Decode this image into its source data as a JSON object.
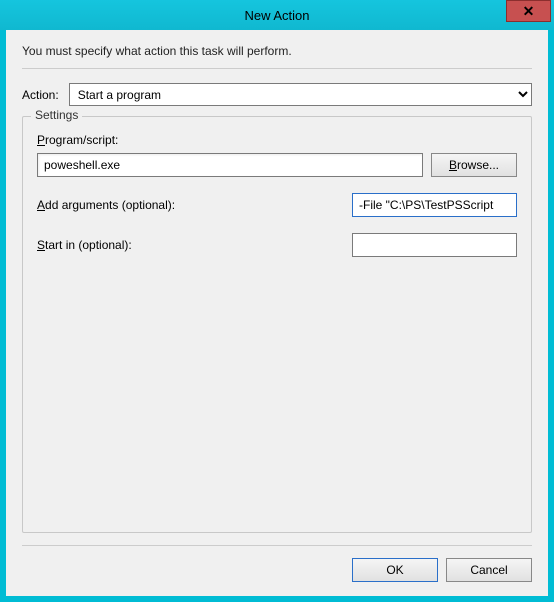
{
  "titlebar": {
    "title": "New Action",
    "close_glyph": "✕"
  },
  "instruction": "You must specify what action this task will perform.",
  "action": {
    "label": "Action:",
    "selected": "Start a program"
  },
  "settings": {
    "legend": "Settings",
    "program": {
      "label_u": "P",
      "label_rest": "rogram/script:",
      "value": "poweshell.exe",
      "browse_u": "B",
      "browse_rest": "rowse..."
    },
    "arguments": {
      "label_u": "A",
      "label_rest": "dd arguments (optional):",
      "value": "-File \"C:\\PS\\TestPSScript"
    },
    "startin": {
      "label_u": "S",
      "label_rest": "tart in (optional):",
      "value": ""
    }
  },
  "buttons": {
    "ok": "OK",
    "cancel": "Cancel"
  }
}
